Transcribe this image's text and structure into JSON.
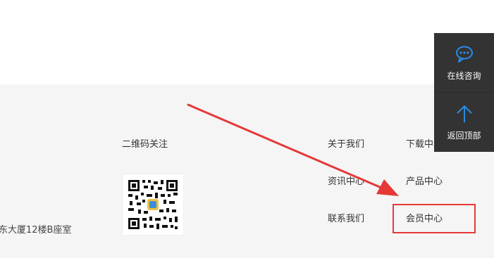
{
  "footer": {
    "qr_title": "二维码关注",
    "address": "东大厦12楼B座室",
    "nav": {
      "about": "关于我们",
      "news": "资讯中心",
      "contact": "联系我们",
      "download": "下载中心",
      "products": "产品中心",
      "member": "会员中心"
    }
  },
  "side_panel": {
    "consult_label": "在线咨询",
    "top_label": "返回顶部",
    "consult_icon": "chat-bubble-icon",
    "top_icon": "arrow-up-icon",
    "background_color": "#333333",
    "icon_color": "#2a8be6"
  },
  "annotation": {
    "highlight_color": "#e53935",
    "arrow_color": "#e53935"
  }
}
